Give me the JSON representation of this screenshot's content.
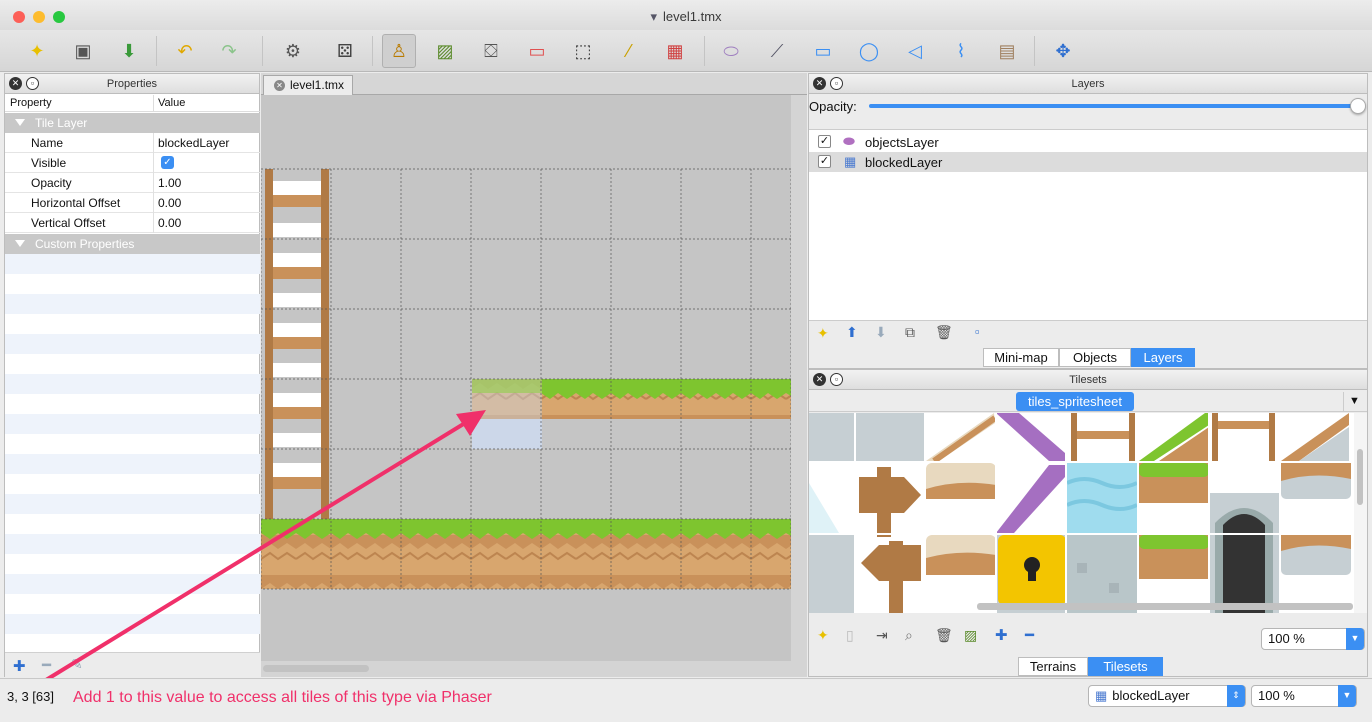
{
  "window": {
    "title": "level1.tmx"
  },
  "toolbar": {
    "icons": [
      "new-map-icon",
      "open-icon",
      "save-icon",
      "undo-icon",
      "redo-icon",
      "commands-icon",
      "random-icon",
      "stamp-brush-icon",
      "terrain-brush-icon",
      "bucket-fill-icon",
      "eraser-icon",
      "rect-select-icon",
      "magic-wand-icon",
      "select-same-tile-icon",
      "select-objects-icon",
      "edit-polygons-icon",
      "insert-rectangle-icon",
      "insert-ellipse-icon",
      "insert-polygon-icon",
      "insert-polyline-icon",
      "insert-tile-icon",
      "move-icon"
    ]
  },
  "properties": {
    "title": "Properties",
    "col_property": "Property",
    "col_value": "Value",
    "group_tile_layer": "Tile Layer",
    "rows": [
      {
        "key": "Name",
        "value": "blockedLayer"
      },
      {
        "key": "Visible",
        "value": ""
      },
      {
        "key": "Opacity",
        "value": "1.00"
      },
      {
        "key": "Horizontal Offset",
        "value": "0.00"
      },
      {
        "key": "Vertical Offset",
        "value": "0.00"
      }
    ],
    "group_custom": "Custom Properties"
  },
  "document": {
    "tab": "level1.tmx"
  },
  "layers_panel": {
    "title": "Layers",
    "opacity_label": "Opacity:",
    "opacity_value": 1.0,
    "items": [
      {
        "name": "objectsLayer",
        "visible": true,
        "icon": "object-layer-icon"
      },
      {
        "name": "blockedLayer",
        "visible": true,
        "icon": "tile-layer-icon",
        "selected": true
      }
    ],
    "tabs": [
      "Mini-map",
      "Objects",
      "Layers"
    ],
    "active_tab": "Layers"
  },
  "tilesets_panel": {
    "title": "Tilesets",
    "tileset_tab": "tiles_spritesheet",
    "zoom": "100 %",
    "tabs": [
      "Terrains",
      "Tilesets"
    ],
    "active_tab": "Tilesets"
  },
  "statusbar": {
    "coords": "3, 3 [63]",
    "annotation": "Add 1 to this value to access all tiles of this type via Phaser",
    "layer": "blockedLayer",
    "zoom": "100 %"
  },
  "colors": {
    "accent": "#3b8ff3",
    "annotation": "#f0306a",
    "grass": "#7ec52f",
    "dirt": "#c9915a"
  }
}
